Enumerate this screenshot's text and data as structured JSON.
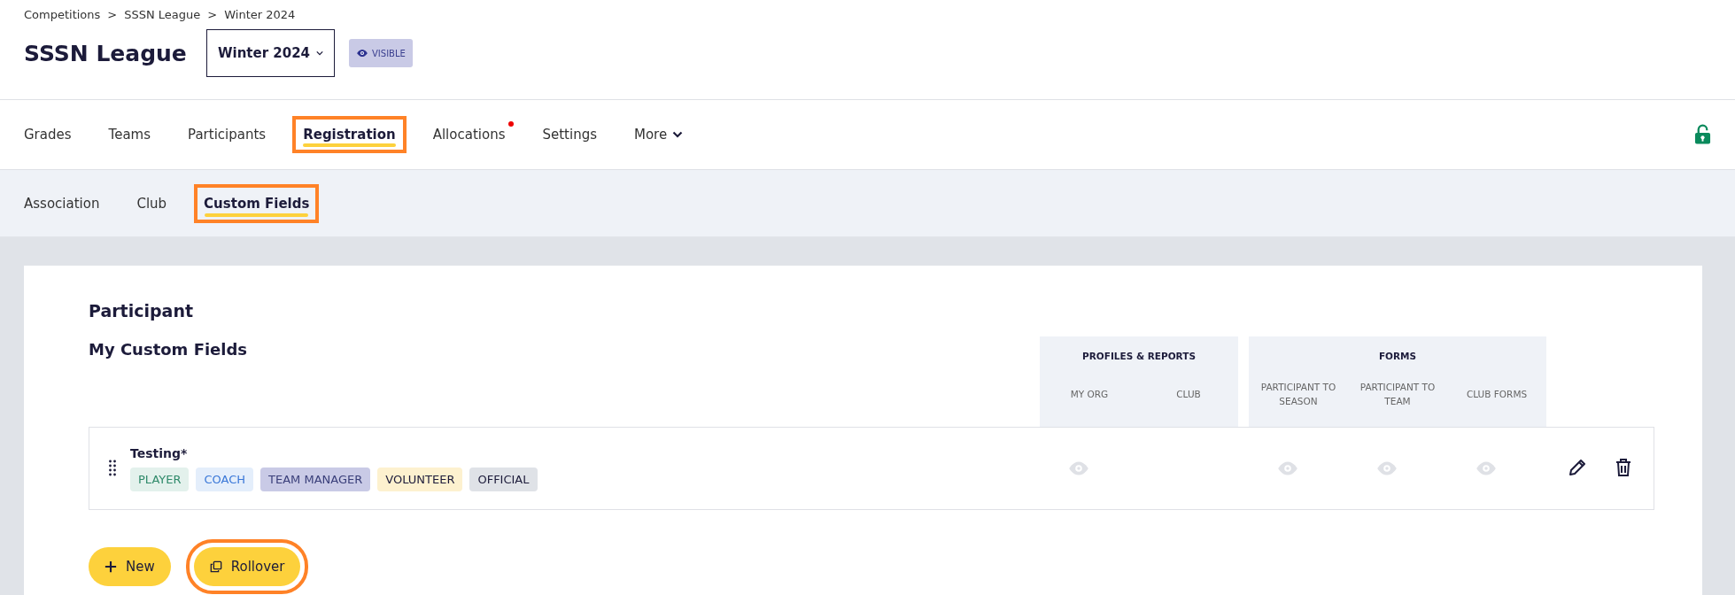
{
  "breadcrumb": {
    "separator": ">",
    "items": [
      "Competitions",
      "SSSN League",
      "Winter 2024"
    ]
  },
  "title": "SSSN League",
  "season_select": {
    "value": "Winter 2024"
  },
  "visibility_badge": {
    "label": "VISIBLE"
  },
  "tabs": [
    {
      "label": "Grades",
      "selected": false,
      "notification": false,
      "highlighted": false
    },
    {
      "label": "Teams",
      "selected": false,
      "notification": false,
      "highlighted": false
    },
    {
      "label": "Participants",
      "selected": false,
      "notification": false,
      "highlighted": false
    },
    {
      "label": "Registration",
      "selected": true,
      "notification": false,
      "highlighted": true
    },
    {
      "label": "Allocations",
      "selected": false,
      "notification": true,
      "highlighted": false
    },
    {
      "label": "Settings",
      "selected": false,
      "notification": false,
      "highlighted": false
    },
    {
      "label": "More",
      "selected": false,
      "notification": false,
      "highlighted": false,
      "dropdown": true
    }
  ],
  "lock": {
    "locked": false
  },
  "subtabs": [
    {
      "label": "Association",
      "selected": false,
      "highlighted": false
    },
    {
      "label": "Club",
      "selected": false,
      "highlighted": false
    },
    {
      "label": "Custom Fields",
      "selected": true,
      "highlighted": true
    }
  ],
  "section_title": "Participant",
  "list_title": "My Custom Fields",
  "column_groups": [
    {
      "title": "PROFILES & REPORTS",
      "columns": [
        "MY ORG",
        "CLUB"
      ]
    },
    {
      "title": "FORMS",
      "columns": [
        "PARTICIPANT TO SEASON",
        "PARTICIPANT TO TEAM",
        "CLUB FORMS"
      ]
    }
  ],
  "fields": [
    {
      "name": "Testing",
      "required_mark": "*",
      "tags": [
        {
          "label": "PLAYER",
          "color": "#e3f1ec"
        },
        {
          "label": "COACH",
          "color": "#e4eefb"
        },
        {
          "label": "TEAM MANAGER",
          "color": "#c9cae6"
        },
        {
          "label": "VOLUNTEER",
          "color": "#fdf1cf"
        },
        {
          "label": "OFFICIAL",
          "color": "#dfe2e7"
        }
      ],
      "visible_in": [
        true,
        false,
        true,
        true,
        true
      ]
    }
  ],
  "buttons": [
    {
      "label": "New",
      "kind": "add",
      "highlighted": false
    },
    {
      "label": "Rollover",
      "kind": "copy",
      "highlighted": true
    }
  ]
}
